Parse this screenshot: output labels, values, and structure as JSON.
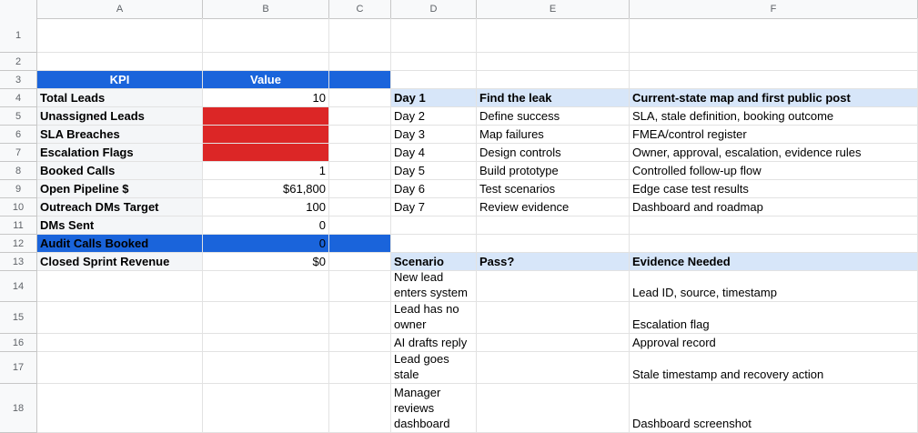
{
  "columns": [
    "A",
    "B",
    "C",
    "D",
    "E",
    "F"
  ],
  "rows": [
    "1",
    "2",
    "3",
    "4",
    "5",
    "6",
    "7",
    "8",
    "9",
    "10",
    "11",
    "12",
    "13",
    "14",
    "15",
    "16",
    "17",
    "18"
  ],
  "kpi_table": {
    "header_kpi": "KPI",
    "header_value": "Value",
    "rows": [
      {
        "label": "Total Leads",
        "value": "10"
      },
      {
        "label": "Unassigned Leads",
        "value": ""
      },
      {
        "label": "SLA Breaches",
        "value": ""
      },
      {
        "label": "Escalation Flags",
        "value": ""
      },
      {
        "label": "Booked Calls",
        "value": "1"
      },
      {
        "label": "Open Pipeline $",
        "value": "$61,800"
      },
      {
        "label": "Outreach DMs Target",
        "value": "100"
      },
      {
        "label": "DMs Sent",
        "value": "0"
      },
      {
        "label": "Audit Calls Booked",
        "value": "0"
      },
      {
        "label": "Closed Sprint Revenue",
        "value": "$0"
      }
    ]
  },
  "plan_table": {
    "rows": [
      {
        "day": "Day 1",
        "task": "Find the leak",
        "deliverable": "Current-state map and first public post"
      },
      {
        "day": "Day 2",
        "task": "Define success",
        "deliverable": "SLA, stale definition, booking outcome"
      },
      {
        "day": "Day 3",
        "task": "Map failures",
        "deliverable": "FMEA/control register"
      },
      {
        "day": "Day 4",
        "task": "Design controls",
        "deliverable": "Owner, approval, escalation, evidence rules"
      },
      {
        "day": "Day 5",
        "task": "Build prototype",
        "deliverable": "Controlled follow-up flow"
      },
      {
        "day": "Day 6",
        "task": "Test scenarios",
        "deliverable": "Edge case test results"
      },
      {
        "day": "Day 7",
        "task": "Review evidence",
        "deliverable": "Dashboard and roadmap"
      }
    ]
  },
  "scenario_table": {
    "header_scenario": "Scenario",
    "header_pass": "Pass?",
    "header_evidence": "Evidence Needed",
    "rows": [
      {
        "scenario_lines": [
          "New lead",
          "enters system"
        ],
        "evidence": "Lead ID, source, timestamp"
      },
      {
        "scenario_lines": [
          "Lead has no",
          "owner"
        ],
        "evidence": "Escalation flag"
      },
      {
        "scenario_lines": [
          "AI drafts reply"
        ],
        "evidence": "Approval record"
      },
      {
        "scenario_lines": [
          "Lead goes",
          "stale"
        ],
        "evidence": "Stale timestamp and recovery action"
      },
      {
        "scenario_lines": [
          "Manager",
          "reviews",
          "dashboard"
        ],
        "evidence": "Dashboard screenshot"
      }
    ]
  },
  "colors": {
    "header_blue": "#1a64db",
    "alert_red": "#dc2626",
    "section_light_blue": "#d7e6f9"
  }
}
